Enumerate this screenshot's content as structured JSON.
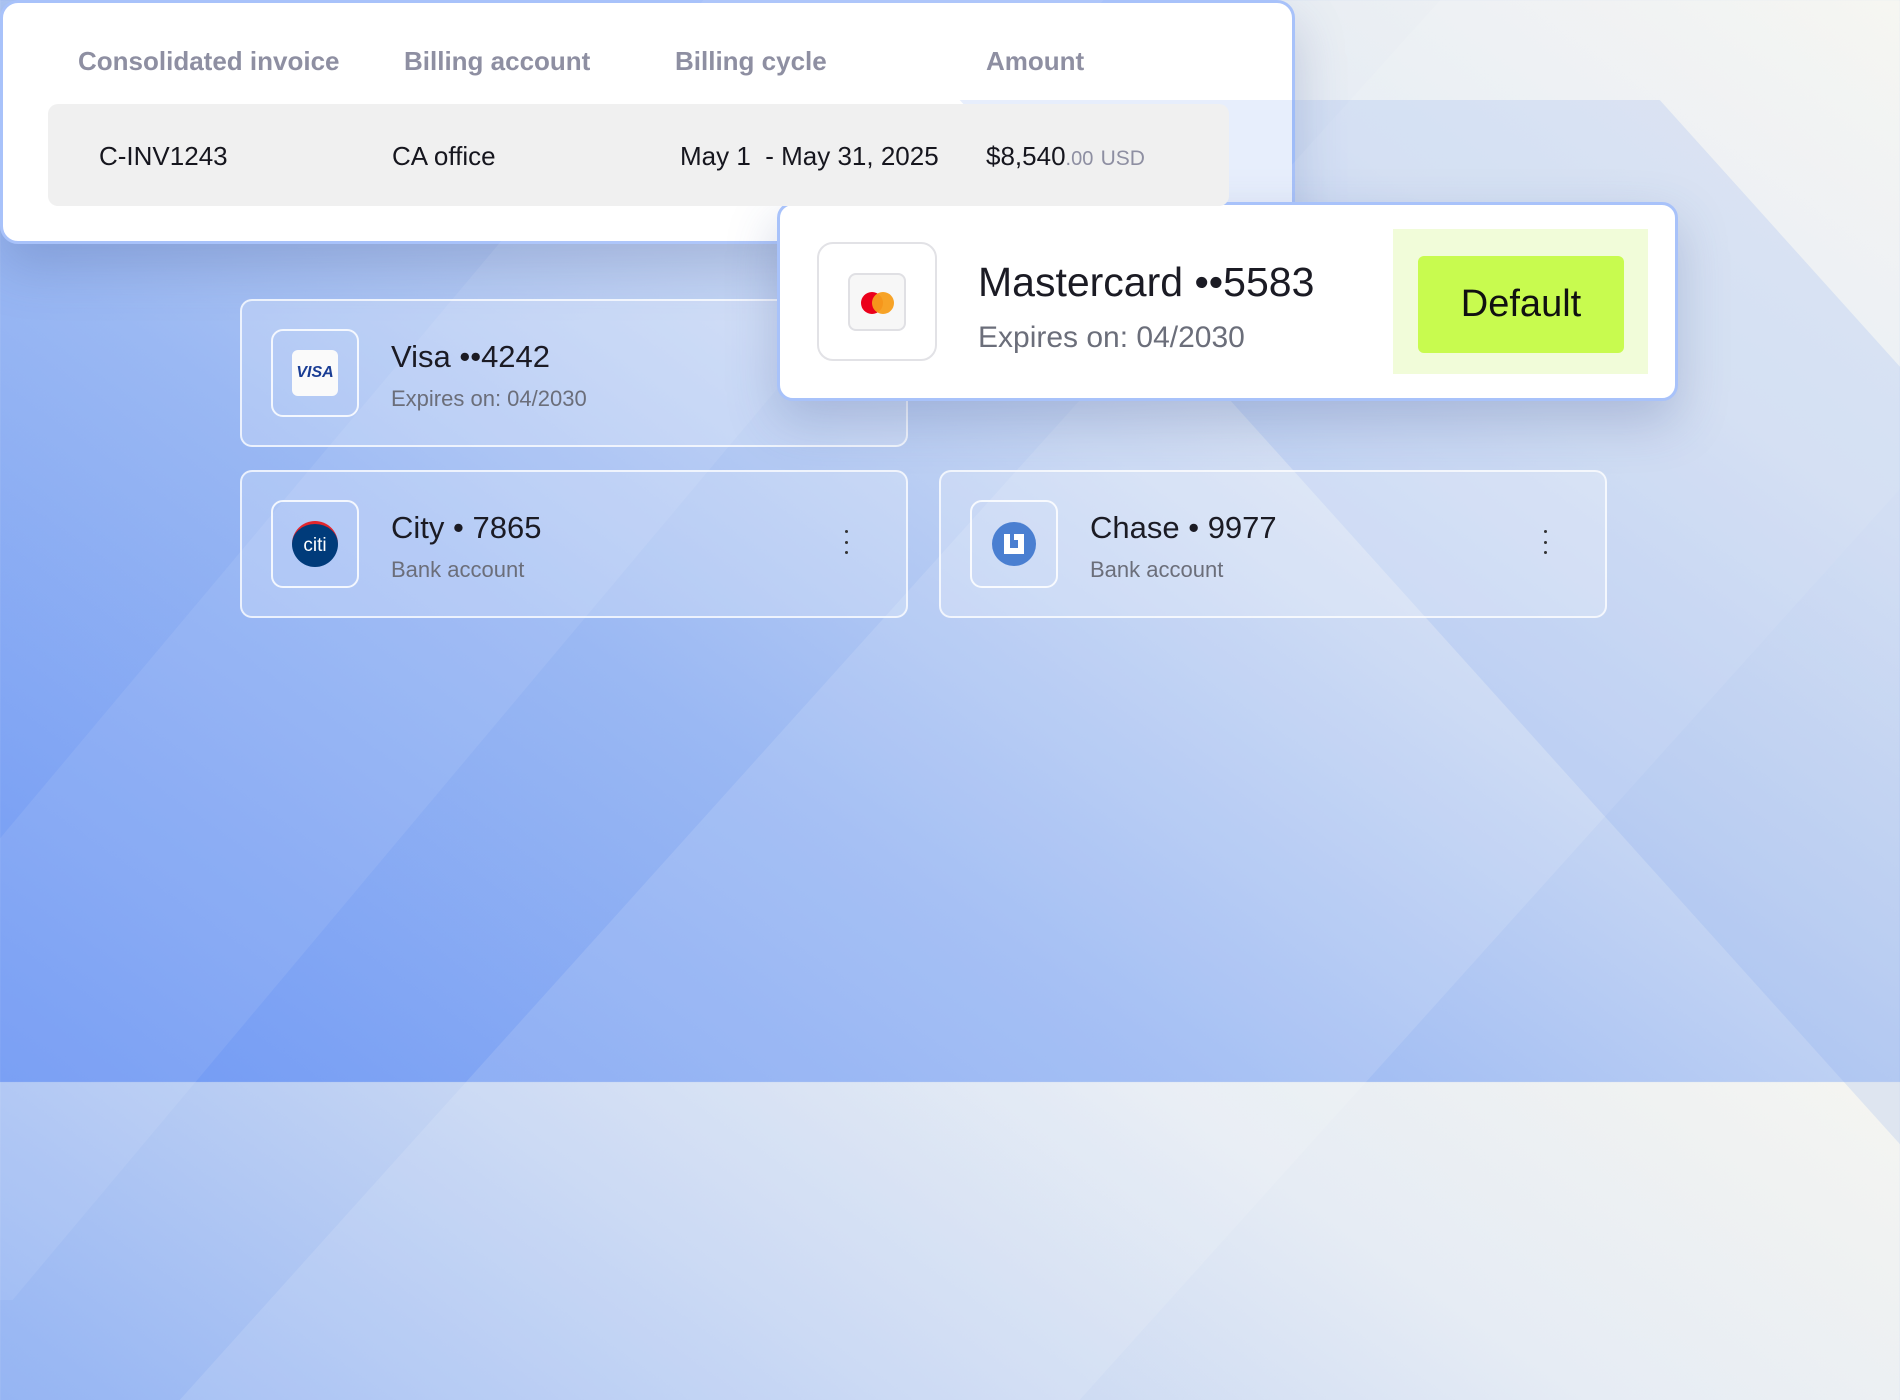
{
  "colors": {
    "accent": "#c8fb4f",
    "highlight": "#f1fcd9",
    "card_border": "#a8c2fa"
  },
  "methods": [
    {
      "name": "Visa ••4242",
      "detail": "Expires on: 04/2030",
      "icon": "visa-logo-icon",
      "logo_text": "VISA"
    },
    {
      "name": "Mastercard ••5583",
      "detail": "Expires on: 04/2030",
      "icon": "mastercard-logo-icon",
      "badge": "Default"
    },
    {
      "name": "City • 7865",
      "detail": "Bank account",
      "icon": "citi-logo-icon",
      "logo_text": "citi"
    },
    {
      "name": "Chase • 9977",
      "detail": "Bank account",
      "icon": "chase-logo-icon"
    }
  ],
  "invoice": {
    "headers": [
      "Consolidated invoice",
      "Billing account",
      "Billing cycle",
      "Amount"
    ],
    "row": {
      "invoice": "C-INV1243",
      "account": "CA office",
      "cycle": "May 1  - May 31, 2025",
      "amount": "$8,540",
      "cents": ".00",
      "currency": "USD"
    }
  }
}
